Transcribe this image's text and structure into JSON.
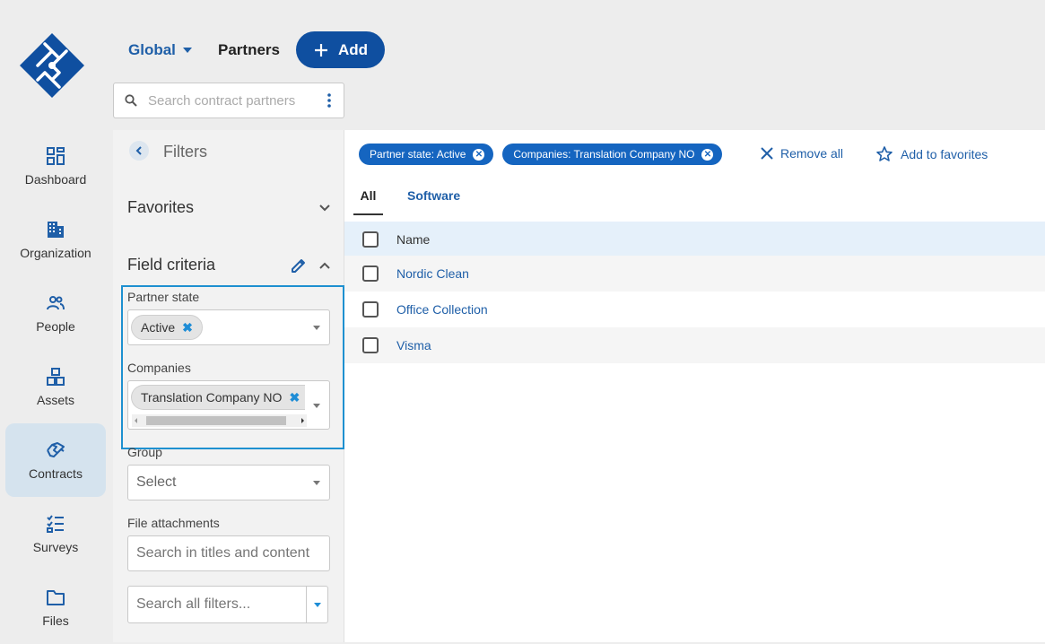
{
  "header": {
    "scope_label": "Global",
    "page_title": "Partners",
    "add_label": "Add"
  },
  "search": {
    "placeholder": "Search contract partners"
  },
  "sidebar": {
    "items": [
      {
        "label": "Dashboard",
        "icon": "dashboard-icon"
      },
      {
        "label": "Organization",
        "icon": "building-icon"
      },
      {
        "label": "People",
        "icon": "people-icon"
      },
      {
        "label": "Assets",
        "icon": "assets-icon"
      },
      {
        "label": "Contracts",
        "icon": "contracts-icon",
        "active": true
      },
      {
        "label": "Surveys",
        "icon": "checklist-icon"
      },
      {
        "label": "Files",
        "icon": "folder-icon"
      }
    ]
  },
  "filters": {
    "title": "Filters",
    "favorites_label": "Favorites",
    "field_criteria_label": "Field criteria",
    "partner_state": {
      "label": "Partner state",
      "chip": "Active"
    },
    "companies": {
      "label": "Companies",
      "chip": "Translation Company NO"
    },
    "group": {
      "label": "Group",
      "value": "Select"
    },
    "file_attachments": {
      "label": "File attachments",
      "placeholder": "Search in titles and content"
    },
    "search_all": {
      "placeholder": "Search all filters..."
    }
  },
  "active_filters": {
    "chips": [
      "Partner state: Active",
      "Companies: Translation Company NO"
    ],
    "remove_all_label": "Remove all",
    "add_favorites_label": "Add to favorites"
  },
  "tabs": [
    {
      "label": "All",
      "active": true
    },
    {
      "label": "Software",
      "active": false
    }
  ],
  "table": {
    "header": "Name",
    "rows": [
      "Nordic Clean",
      "Office Collection",
      "Visma"
    ]
  },
  "colors": {
    "accent": "#1565c0",
    "brand": "#0f4fa0",
    "highlight_border": "#1e90d0",
    "nav_active_bg": "#d5e3ee"
  }
}
